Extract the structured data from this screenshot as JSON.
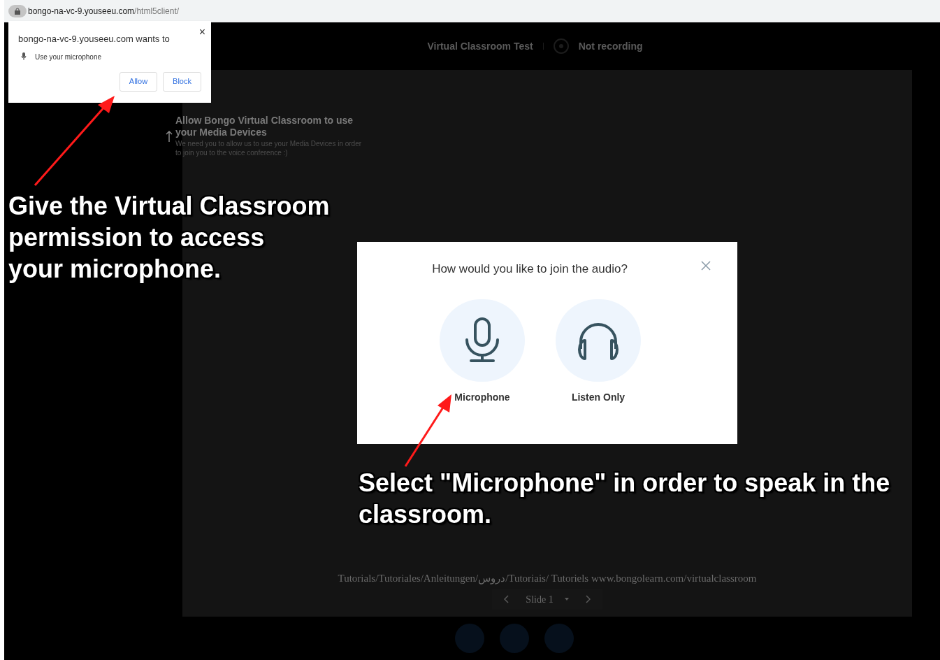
{
  "address_bar": {
    "host": "bongo-na-vc-9.youseeu.com",
    "path": "/html5client/"
  },
  "permission_prompt": {
    "title": "bongo-na-vc-9.youseeu.com wants to",
    "request": "Use your microphone",
    "close": "×",
    "buttons": [
      "Allow",
      "Block"
    ]
  },
  "header": {
    "meeting_title": "Virtual Classroom Test",
    "recording_status": "Not recording"
  },
  "media_hint": {
    "title": "Allow Bongo Virtual Classroom to use your Media Devices",
    "body": "We need you to allow us to use your Media Devices in order to join you to the voice conference :)"
  },
  "audio_modal": {
    "title": "How would you like to join the audio?",
    "options": [
      {
        "kind": "microphone",
        "label": "Microphone"
      },
      {
        "kind": "listen",
        "label": "Listen Only"
      }
    ]
  },
  "slide": {
    "footer": "Tutorials/Tutoriales/Anleitungen/دروس/Tutoriais/ Tutoriels www.bongolearn.com/virtualclassroom",
    "slide_label": "Slide 1"
  },
  "annotations": [
    {
      "text": "Give the Virtual Classroom\npermission to access\nyour microphone."
    },
    {
      "text": "Select \"Microphone\" in order to speak in the classroom."
    }
  ]
}
